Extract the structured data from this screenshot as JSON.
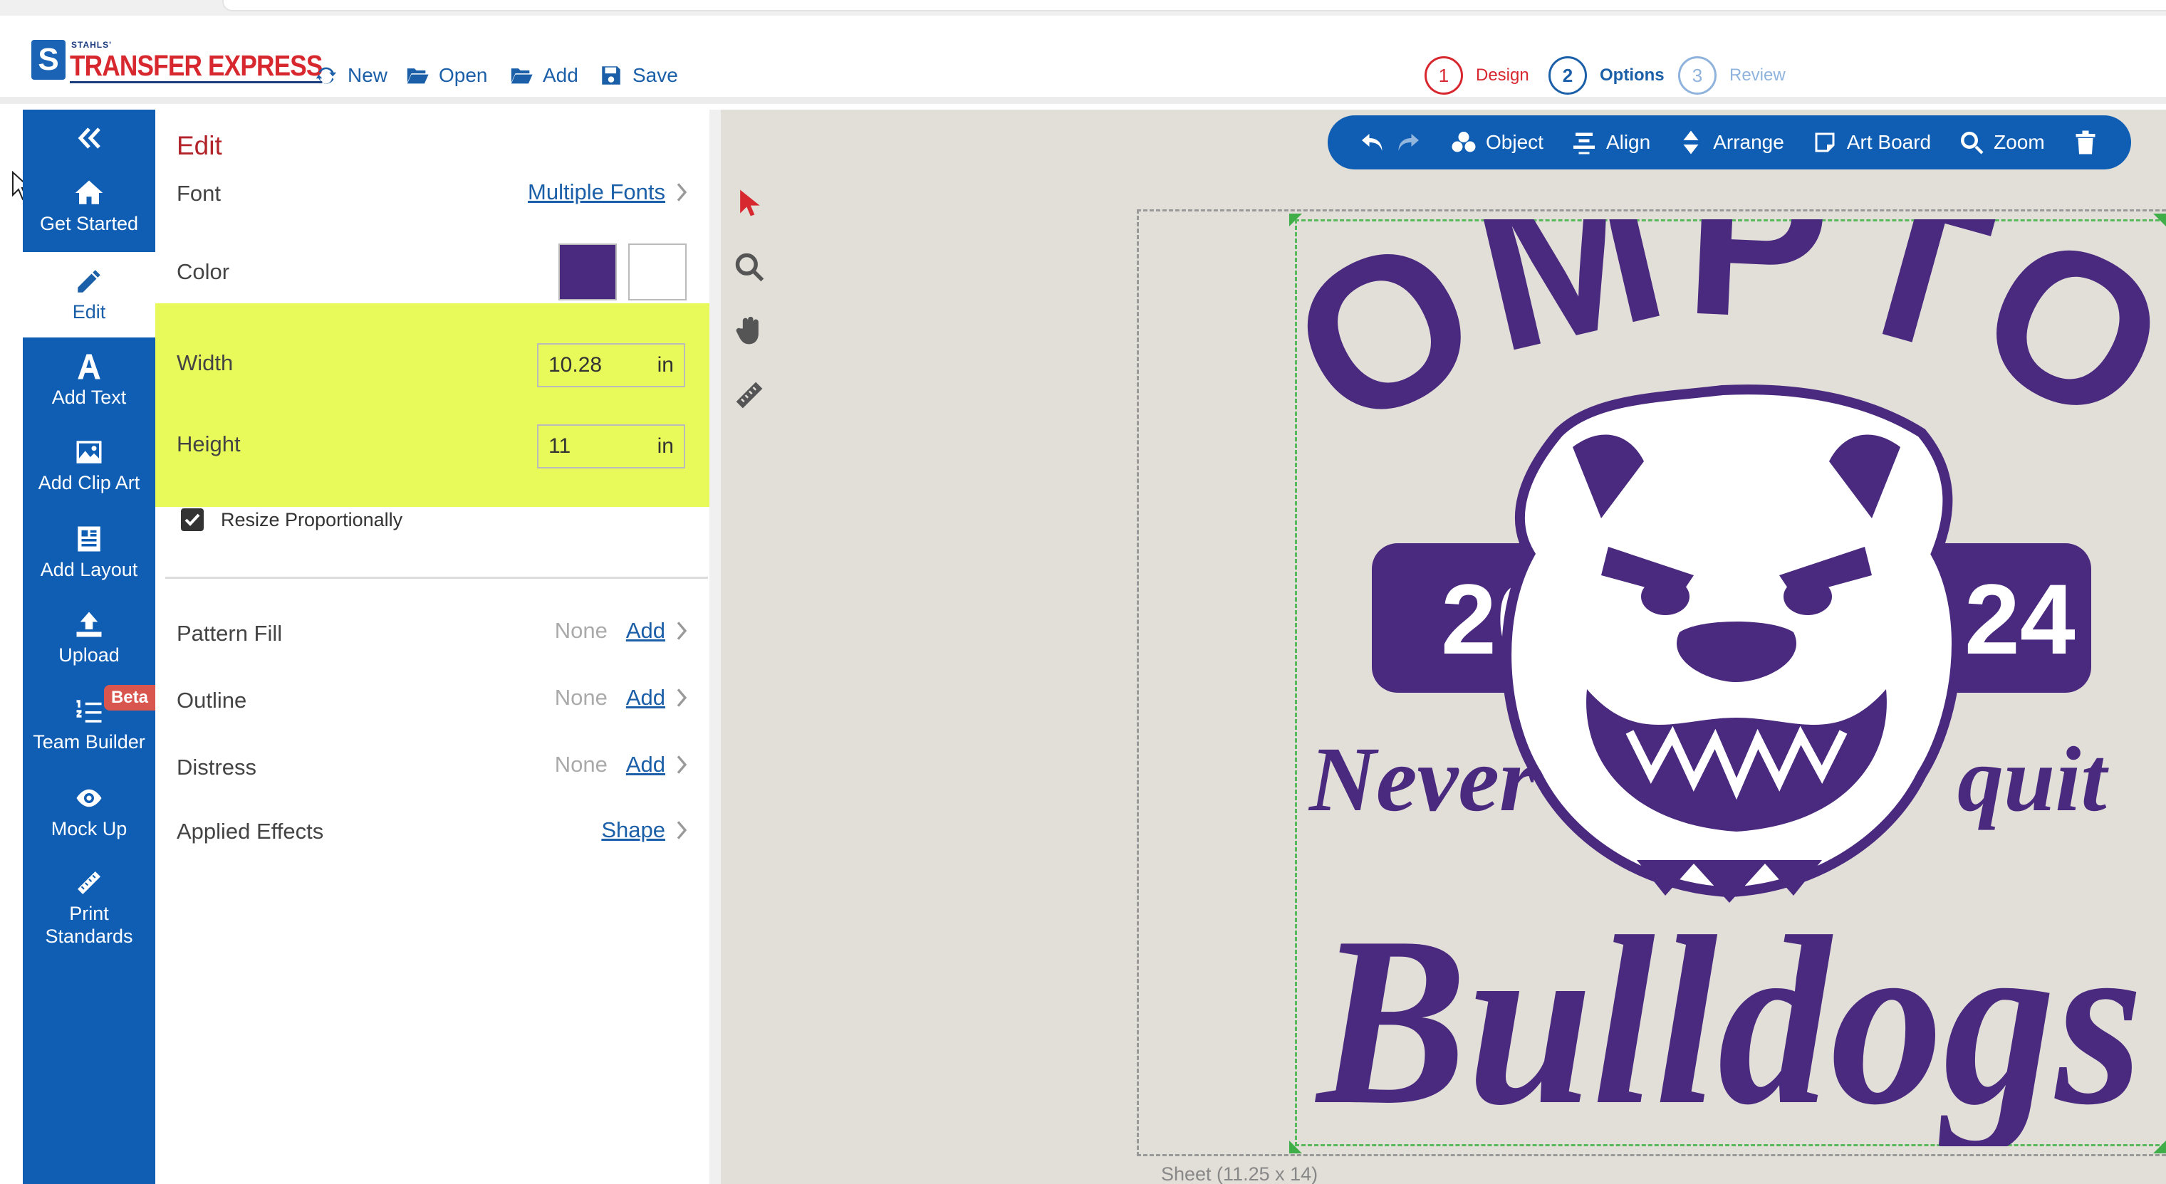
{
  "brand": {
    "small": "STAHLS'",
    "name": "TRANSFER EXPRESS"
  },
  "toolbar": {
    "new": "New",
    "open": "Open",
    "add": "Add",
    "save": "Save"
  },
  "steps": [
    {
      "num": "1",
      "label": "Design",
      "color": "#d8282f"
    },
    {
      "num": "2",
      "label": "Options",
      "color": "#1b5fa8"
    },
    {
      "num": "3",
      "label": "Review",
      "color": "#8fb3dc"
    }
  ],
  "sidebar": {
    "items": [
      {
        "label": "Get Started"
      },
      {
        "label": "Edit"
      },
      {
        "label": "Add Text"
      },
      {
        "label": "Add Clip Art"
      },
      {
        "label": "Add Layout"
      },
      {
        "label": "Upload"
      },
      {
        "label": "Team Builder",
        "badge": "Beta"
      },
      {
        "label": "Mock Up"
      },
      {
        "label": "Print Standards"
      }
    ]
  },
  "panel": {
    "title": "Edit",
    "font_label": "Font",
    "font_value": "Multiple Fonts",
    "color_label": "Color",
    "colors": [
      "#4a2a7f",
      "#ffffff"
    ],
    "width_label": "Width",
    "width_value": "10.28",
    "height_label": "Height",
    "height_value": "11",
    "unit": "in",
    "resize_label": "Resize Proportionally",
    "pattern_label": "Pattern Fill",
    "outline_label": "Outline",
    "distress_label": "Distress",
    "none_text": "None",
    "add_text": "Add",
    "effects_label": "Applied Effects",
    "effects_value": "Shape"
  },
  "canvas_toolbar": {
    "object": "Object",
    "align": "Align",
    "arrange": "Arrange",
    "artboard": "Art Board",
    "zoom": "Zoom"
  },
  "design": {
    "top": "COMPTON",
    "year_left": "20",
    "year_right": "24",
    "never": "Never",
    "quit": "quit",
    "bottom": "Bulldogs",
    "ink": "#4a2a7f"
  },
  "sheet_label": "Sheet (11.25 x 14)",
  "accent": "#0f5eb4",
  "highlight": "#e8f95a"
}
